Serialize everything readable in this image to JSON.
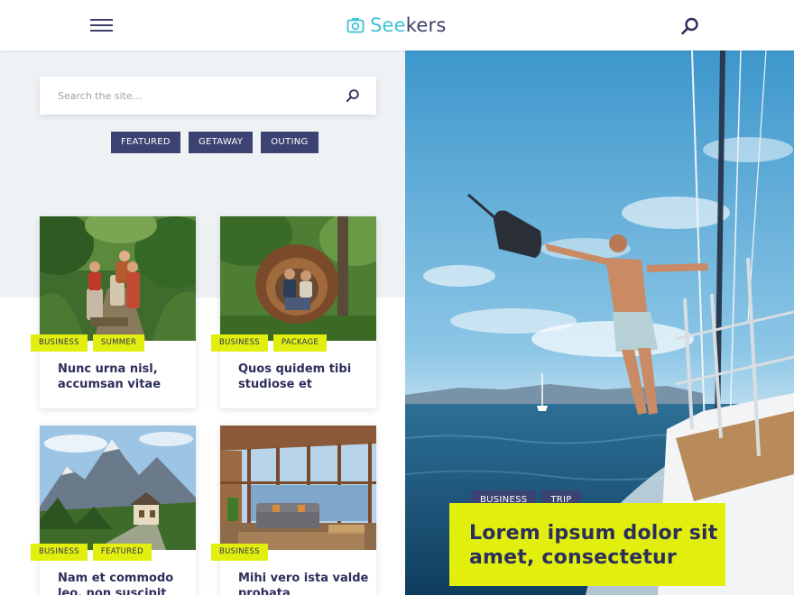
{
  "header": {
    "menu_icon": "hamburger-menu-icon",
    "logo_icon": "camera-icon",
    "logo_prefix": "See",
    "logo_suffix": "kers",
    "search_icon": "search-icon",
    "accent_color": "#3ec3d5"
  },
  "search": {
    "placeholder": "Search the site...",
    "value": ""
  },
  "filter_tags": [
    "FEATURED",
    "GETAWAY",
    "OUTING"
  ],
  "cards": [
    {
      "badges": [
        "BUSINESS",
        "SUMMER"
      ],
      "title": "Nunc urna nisl, accumsan vitae",
      "image": "jungle-trekkers-photo"
    },
    {
      "badges": [
        "BUSINESS",
        "PACKAGE"
      ],
      "title": "Quos quidem tibi studiose et",
      "image": "nest-couple-photo"
    },
    {
      "badges": [
        "BUSINESS",
        "FEATURED"
      ],
      "title": "Nam et commodo leo, non suscipit",
      "image": "mountain-chalet-photo"
    },
    {
      "badges": [
        "BUSINESS"
      ],
      "title": "Mihi vero ista valde probata",
      "image": "sunroom-interior-photo"
    }
  ],
  "hero": {
    "image": "sailboat-man-photo",
    "badges": [
      "BUSINESS",
      "TRIP"
    ],
    "title": "Lorem ipsum dolor sit amet, consectetur"
  },
  "colors": {
    "navy": "#3c4372",
    "lime": "#e2ef0e",
    "text": "#2c2f5b",
    "panel": "#eef2f5"
  }
}
